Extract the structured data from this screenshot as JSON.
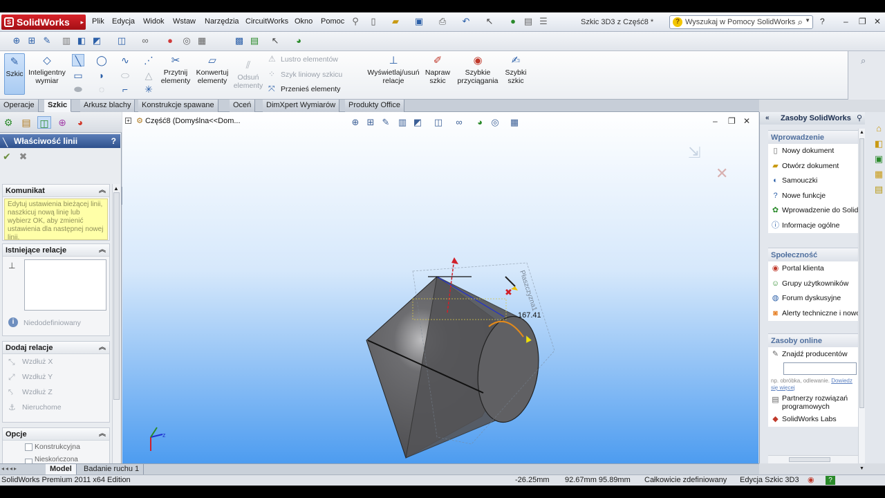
{
  "app": {
    "logo": "SolidWorks",
    "menu": [
      "Plik",
      "Edycja",
      "Widok",
      "Wstaw",
      "Narzędzia",
      "CircuitWorks",
      "Okno",
      "Pomoc"
    ],
    "document_title": "Szkic 3D3 z Część8 *",
    "help_search_placeholder": "Wyszukaj w Pomocy SolidWorks"
  },
  "command_manager": {
    "sketch": "Szkic",
    "smart_dimension": [
      "Inteligentny",
      "wymiar"
    ],
    "trim": [
      "Przytnij",
      "elementy"
    ],
    "convert": [
      "Konwertuj",
      "elementy"
    ],
    "offset": [
      "Odsuń",
      "elementy"
    ],
    "mirror": "Lustro elementów",
    "linear_pattern": "Szyk liniowy szkicu",
    "move": "Przenieś elementy",
    "relations": [
      "Wyświetlaj/usuń",
      "relacje"
    ],
    "repair": [
      "Napraw",
      "szkic"
    ],
    "quick_snaps": [
      "Szybkie",
      "przyciągania"
    ],
    "rapid_sketch": [
      "Szybki",
      "szkic"
    ]
  },
  "tabs": [
    "Operacje",
    "Szkic",
    "Arkusz blachy",
    "Konstrukcje spawane",
    "Oceń",
    "DimXpert Wymiarów",
    "Produkty Office"
  ],
  "active_tab": "Szkic",
  "property_manager": {
    "title": "Właściwość linii",
    "help": "?",
    "message_header": "Komunikat",
    "message": "Edytuj ustawienia bieżącej linii, naszkicuj nową linię lub wybierz OK, aby zmienić ustawienia dla następnej nowej linii.",
    "existing_relations_header": "Istniejące relacje",
    "status": "Niedodefiniowany",
    "add_relations_header": "Dodaj relacje",
    "add_relations": [
      "Wzdłuż X",
      "Wzdłuż Y",
      "Wzdłuż Z",
      "Nieruchome"
    ],
    "options_header": "Opcje",
    "options": [
      "Konstrukcyjna",
      "Nieskończona długość"
    ]
  },
  "viewport": {
    "tree_node": "Część8  (Domyślna<<Dom...",
    "dimension": "167.41",
    "plane_label": "Płaszczyzna1",
    "colors": {
      "body": "#5a5a5c",
      "sketch": "#1a1a1a",
      "highlight": "#e28a1c",
      "axis_x": "#d0202a"
    }
  },
  "task_pane": {
    "title": "Zasoby SolidWorks",
    "sections": [
      {
        "title": "Wprowadzenie",
        "items": [
          "Nowy dokument",
          "Otwórz dokument",
          "Samouczki",
          "Nowe funkcje",
          "Wprowadzenie do SolidWorks",
          "Informacje ogólne"
        ]
      },
      {
        "title": "Społeczność",
        "items": [
          "Portal klienta",
          "Grupy użytkowników",
          "Forum dyskusyjne",
          "Alerty techniczne i nowości"
        ]
      },
      {
        "title": "Zasoby online",
        "items": [
          "Znajdź producentów"
        ],
        "hint": "np. obróbka, odlewanie.",
        "hint_link": "Dowiedz się więcej",
        "extra_items": [
          "Partnerzy rozwiązań programowych",
          "SolidWorks Labs"
        ]
      }
    ]
  },
  "bottom_tabs": [
    "Model",
    "Badanie ruchu 1"
  ],
  "status": {
    "edition": "SolidWorks Premium 2011 x64 Edition",
    "x": "-26.25mm",
    "yz": "92.67mm 95.89mm",
    "definition": "Całkowicie zdefiniowany",
    "editing": "Edycja Szkic 3D3"
  }
}
